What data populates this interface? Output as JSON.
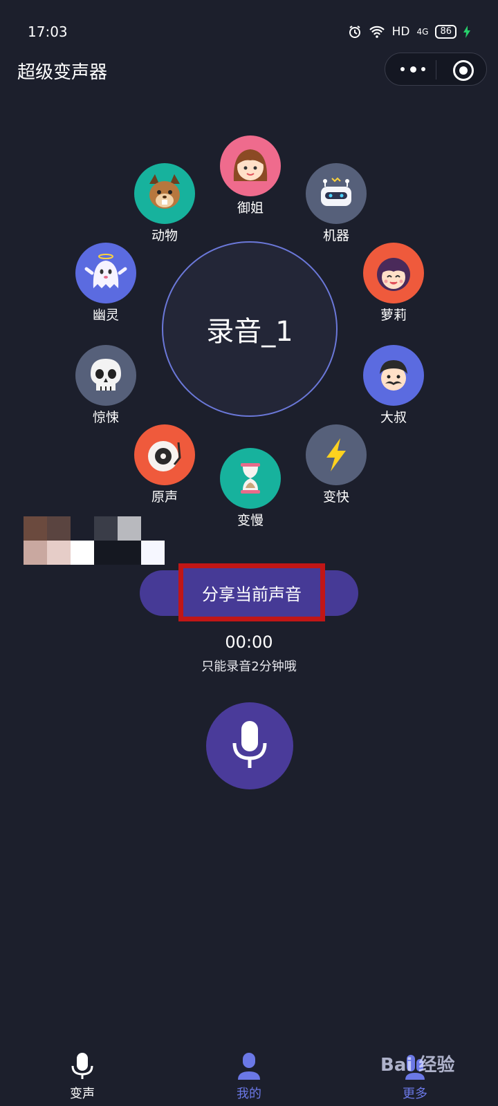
{
  "status": {
    "time": "17:03",
    "network": "HD",
    "signal": "4G",
    "battery": "86"
  },
  "header": {
    "title": "超级变声器"
  },
  "main": {
    "current_recording": "录音_1",
    "voices": [
      {
        "label": "御姐",
        "icon": "lady-avatar-icon",
        "color": "#ef6b8d"
      },
      {
        "label": "动物",
        "icon": "squirrel-icon",
        "color": "#17b29d"
      },
      {
        "label": "机器",
        "icon": "robot-icon",
        "color": "#56607a"
      },
      {
        "label": "幽灵",
        "icon": "ghost-icon",
        "color": "#5b6be0"
      },
      {
        "label": "萝莉",
        "icon": "girl-avatar-icon",
        "color": "#ef5a3c"
      },
      {
        "label": "惊悚",
        "icon": "skull-icon",
        "color": "#56607a"
      },
      {
        "label": "大叔",
        "icon": "uncle-avatar-icon",
        "color": "#5b6be0"
      },
      {
        "label": "原声",
        "icon": "vinyl-icon",
        "color": "#ef5a3c"
      },
      {
        "label": "变快",
        "icon": "lightning-icon",
        "color": "#56607a"
      },
      {
        "label": "变慢",
        "icon": "hourglass-icon",
        "color": "#17b29d"
      }
    ],
    "share_label": "分享当前声音",
    "timer": "00:00",
    "hint": "只能录音2分钟哦"
  },
  "tabbar": {
    "items": [
      {
        "label": "变声",
        "icon": "mic-icon",
        "color": "#ffffff"
      },
      {
        "label": "我的",
        "icon": "user-icon",
        "color": "#6b78e6"
      },
      {
        "label": "更多",
        "icon": "more-icon",
        "color": "#6b78e6"
      }
    ]
  },
  "watermark": "Bai 经验"
}
